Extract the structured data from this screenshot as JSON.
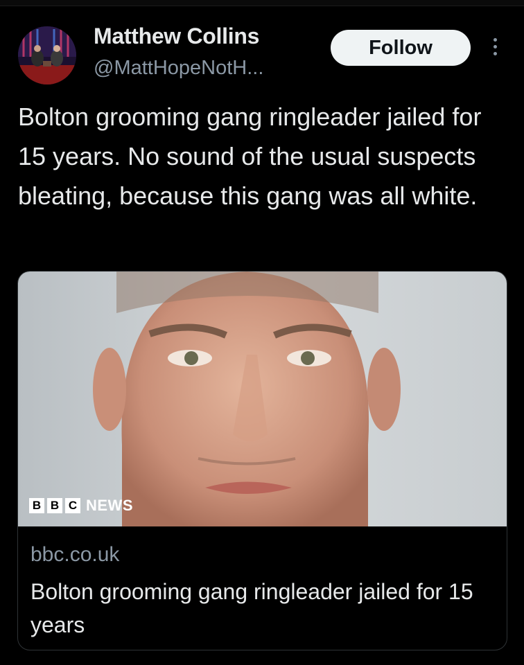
{
  "author": {
    "name": "Matthew Collins",
    "handle": "@MattHopeNotH..."
  },
  "actions": {
    "follow_label": "Follow"
  },
  "tweet": {
    "text": "Bolton grooming gang ringleader jailed for 15 years. No sound of the usual suspects bleating, because this gang was all white."
  },
  "link_card": {
    "logo": {
      "letters": [
        "B",
        "B",
        "C"
      ],
      "word": "NEWS"
    },
    "domain": "bbc.co.uk",
    "title": "Bolton grooming gang ringleader jailed for 15 years"
  },
  "colors": {
    "background": "#000000",
    "text_primary": "#e7e9ea",
    "text_secondary": "#8b98a5",
    "follow_bg": "#eff3f4",
    "card_border": "#2f3336"
  },
  "icons": [
    "avatar",
    "more-options-icon",
    "bbc-news-logo",
    "mugshot-photo"
  ]
}
